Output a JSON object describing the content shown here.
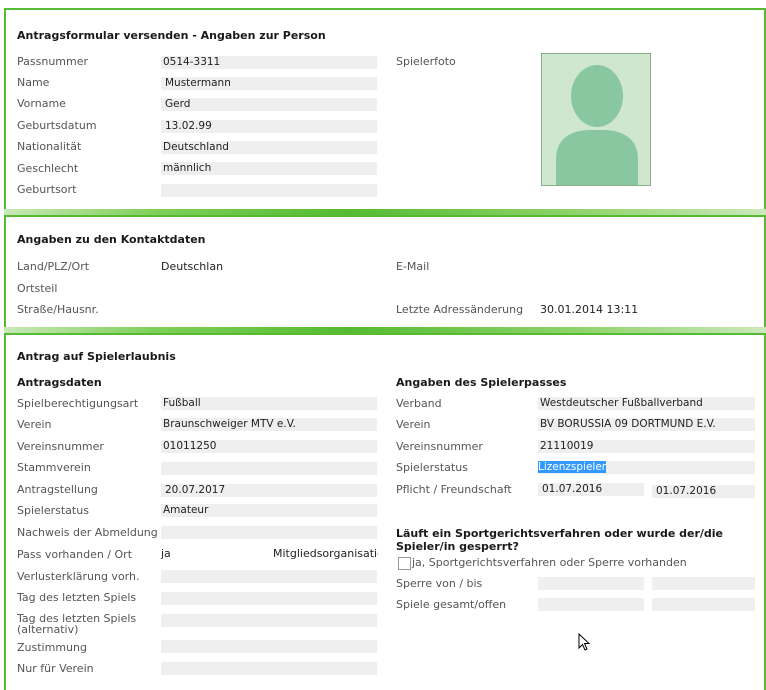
{
  "sec1": {
    "title": "Antragsformular versenden - Angaben zur Person",
    "labels": [
      "Passnummer",
      "Name",
      "Vorname",
      "Geburtsdatum",
      "Nationalität",
      "Geschlecht",
      "Geburtsort"
    ],
    "values": [
      "0514-3311",
      "Mustermann",
      "Gerd",
      "13.02.99",
      "Deutschland",
      "männlich",
      ""
    ],
    "photo_label": "Spielerfoto"
  },
  "sec2": {
    "title": "Angaben zu den Kontaktdaten",
    "labels": [
      "Land/PLZ/Ort",
      "Ortsteil",
      "Straße/Hausnr."
    ],
    "land_value": "Deutschlanı",
    "email_label": "E-Mail",
    "last_change_label": "Letzte Adressänderung",
    "last_change_value": "30.01.2014 13:11"
  },
  "sec3": {
    "title": "Antrag auf Spielerlaubnis",
    "left_title": "Antragsdaten",
    "left_labels": [
      "Spielberechtigungsart",
      "Verein",
      "Vereinsnummer",
      "Stammverein",
      "Antragstellung",
      "Spielerstatus",
      "Nachweis der Abmeldung",
      "Pass vorhanden / Ort",
      "Verlusterklärung vorh.",
      "Tag des letzten Spiels",
      "Tag des letzten Spiels (alternativ)",
      "Zustimmung",
      "Nur für Verein"
    ],
    "left_values": [
      "Fußball",
      "Braunschweiger MTV e.V.",
      "01011250",
      "",
      "20.07.2017",
      "Amateur",
      "",
      "ja",
      "",
      "",
      "",
      "",
      ""
    ],
    "pass_org": "Mitgliedsorganisation",
    "right_title": "Angaben des Spielerpasses",
    "right_labels": [
      "Verband",
      "Verein",
      "Vereinsnummer",
      "Spielerstatus",
      "Pflicht / Freundschaft"
    ],
    "right_values": [
      "Westdeutscher Fußballverband",
      "BV BORUSSIA 09 DORTMUND E.V.",
      "21110019",
      "Lizenzspieler",
      "01.07.2016"
    ],
    "freundschaft_value": "01.07.2016",
    "question": "Läuft ein Sportgerichtsverfahren oder wurde der/die Spieler/in gesperrt?",
    "checkbox_label": "ja, Sportgerichtsverfahren oder Sperre vorhanden",
    "sperre_label": "Sperre von / bis",
    "spiele_label": "Spiele gesamt/offen"
  }
}
